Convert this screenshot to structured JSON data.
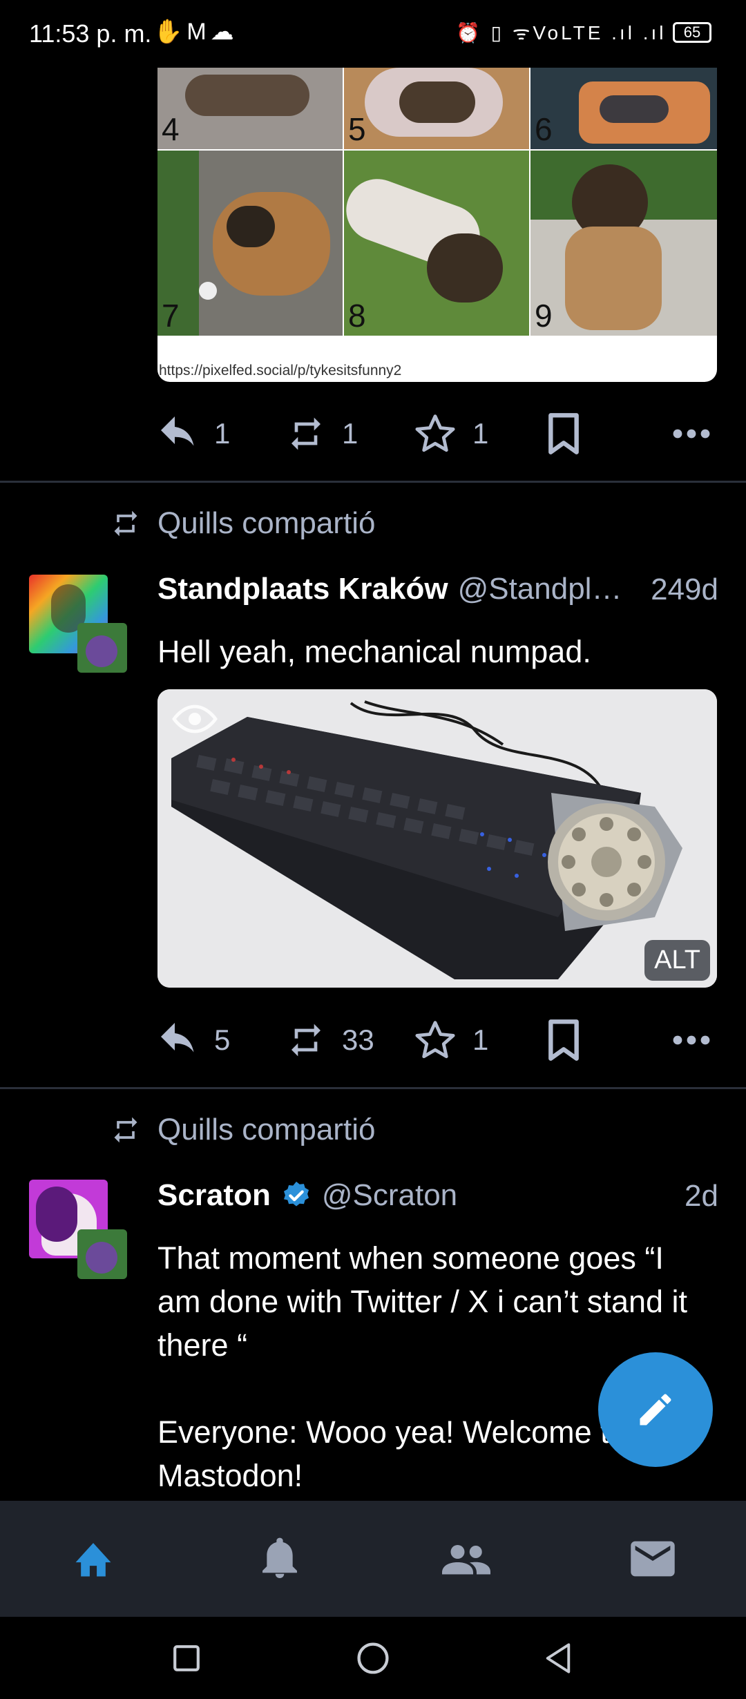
{
  "status_bar": {
    "time": "11:53 p. m.",
    "left_icons": [
      "hand-icon",
      "gmail-icon",
      "cloud-icon"
    ],
    "left_icons_glyphs": "✋M☁",
    "right_icons": [
      "alarm-icon",
      "vibrate-icon",
      "wifi-icon",
      "volte-icon",
      "signal-icon",
      "signal-icon"
    ],
    "right_icons_text": "⏰ ▯ ᯤVoLTE .ıl .ıl",
    "battery": "65"
  },
  "post1": {
    "collage_numbers": [
      "4",
      "5",
      "6",
      "7",
      "8",
      "9"
    ],
    "collage_url": "https://pixelfed.social/p/tykesitsfunny2",
    "actions": {
      "reply_count": "1",
      "boost_count": "1",
      "favourite_count": "1"
    }
  },
  "post2": {
    "boosted_by": "Quills compartió",
    "display_name": "Standplaats Kraków",
    "handle": "@Standpl…",
    "time": "249d",
    "text": "Hell yeah, mechanical numpad.",
    "media_alt_badge": "ALT",
    "actions": {
      "reply_count": "5",
      "boost_count": "33",
      "favourite_count": "1"
    }
  },
  "post3": {
    "boosted_by": "Quills compartió",
    "display_name": "Scraton",
    "handle": "@Scraton",
    "time": "2d",
    "verified": true,
    "text": "That moment when someone goes “I am done with Twitter / X i can’t stand it there “\n\nEveryone: Wooo yea! Welcome to Mastodon!"
  },
  "bottom_nav": [
    "home-icon",
    "notifications-icon",
    "people-icon",
    "messages-icon"
  ],
  "colors": {
    "accent": "#2b90d9",
    "muted": "#aab4c8",
    "nav_bg": "#1f232b"
  }
}
